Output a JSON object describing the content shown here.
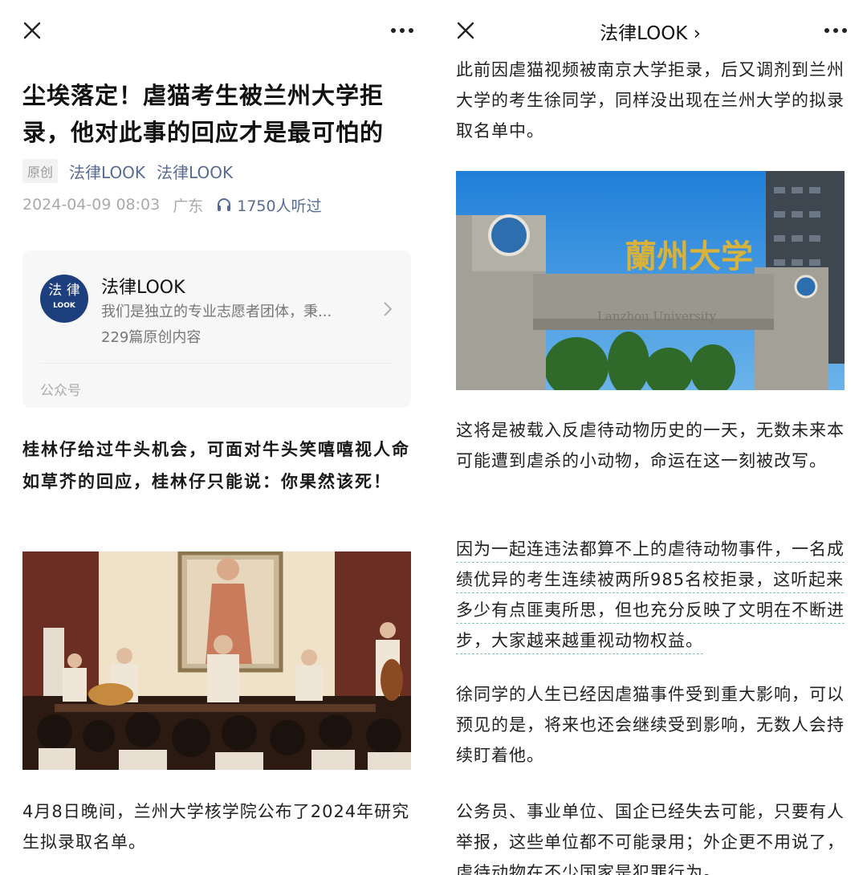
{
  "left": {
    "topbar": {
      "close_icon": "close-icon",
      "more_icon": "more-icon"
    },
    "article": {
      "title": "尘埃落定！虐猫考生被兰州大学拒录，他对此事的回应才是最可怕的",
      "badge": "原创",
      "author": "法律LOOK",
      "account": "法律LOOK",
      "datetime": "2024-04-09 08:03",
      "region": "广东",
      "listen_count": "1750人听过"
    },
    "card": {
      "avatar_top": "法 律",
      "avatar_bottom": "LOOK",
      "name": "法律LOOK",
      "desc": "我们是独立的专业志愿者团体，秉...",
      "count": "229篇原创内容",
      "type": "公众号"
    },
    "bold_paragraph": "桂林仔给过牛头机会，可面对牛头笑嘻嘻视人命如草芥的回应，桂林仔只能说：你果然该死！",
    "photo_icon": "theater-photo",
    "paragraph": "4月8日晚间，兰州大学核学院公布了2024年研究生拟录取名单。"
  },
  "right": {
    "topbar": {
      "title": "法律LOOK",
      "close_icon": "close-icon",
      "more_icon": "more-icon"
    },
    "paragraph1": "此前因虐猫视频被南京大学拒录，后又调剂到兰州大学的考生徐同学，同样没出现在兰州大学的拟录取名单中。",
    "gate": {
      "sign": "蘭州大学",
      "sign_en": "Lanzhou University"
    },
    "paragraph2": "这将是被载入反虐待动物历史的一天，无数未来本可能遭到虐杀的小动物，命运在这一刻被改写。",
    "paragraph3": "因为一起连违法都算不上的虐待动物事件，一名成绩优异的考生连续被两所985名校拒录，这听起来多少有点匪夷所思，但也充分反映了文明在不断进步，大家越来越重视动物权益。",
    "paragraph4": "徐同学的人生已经因虐猫事件受到重大影响，可以预见的是，将来也还会继续受到影响，无数人会持续盯着他。",
    "paragraph5": "公务员、事业单位、国企已经失去可能，只要有人举报，这些单位都不可能录用；外企更不用说了，虐待动物在不少国家是犯罪行为。"
  }
}
